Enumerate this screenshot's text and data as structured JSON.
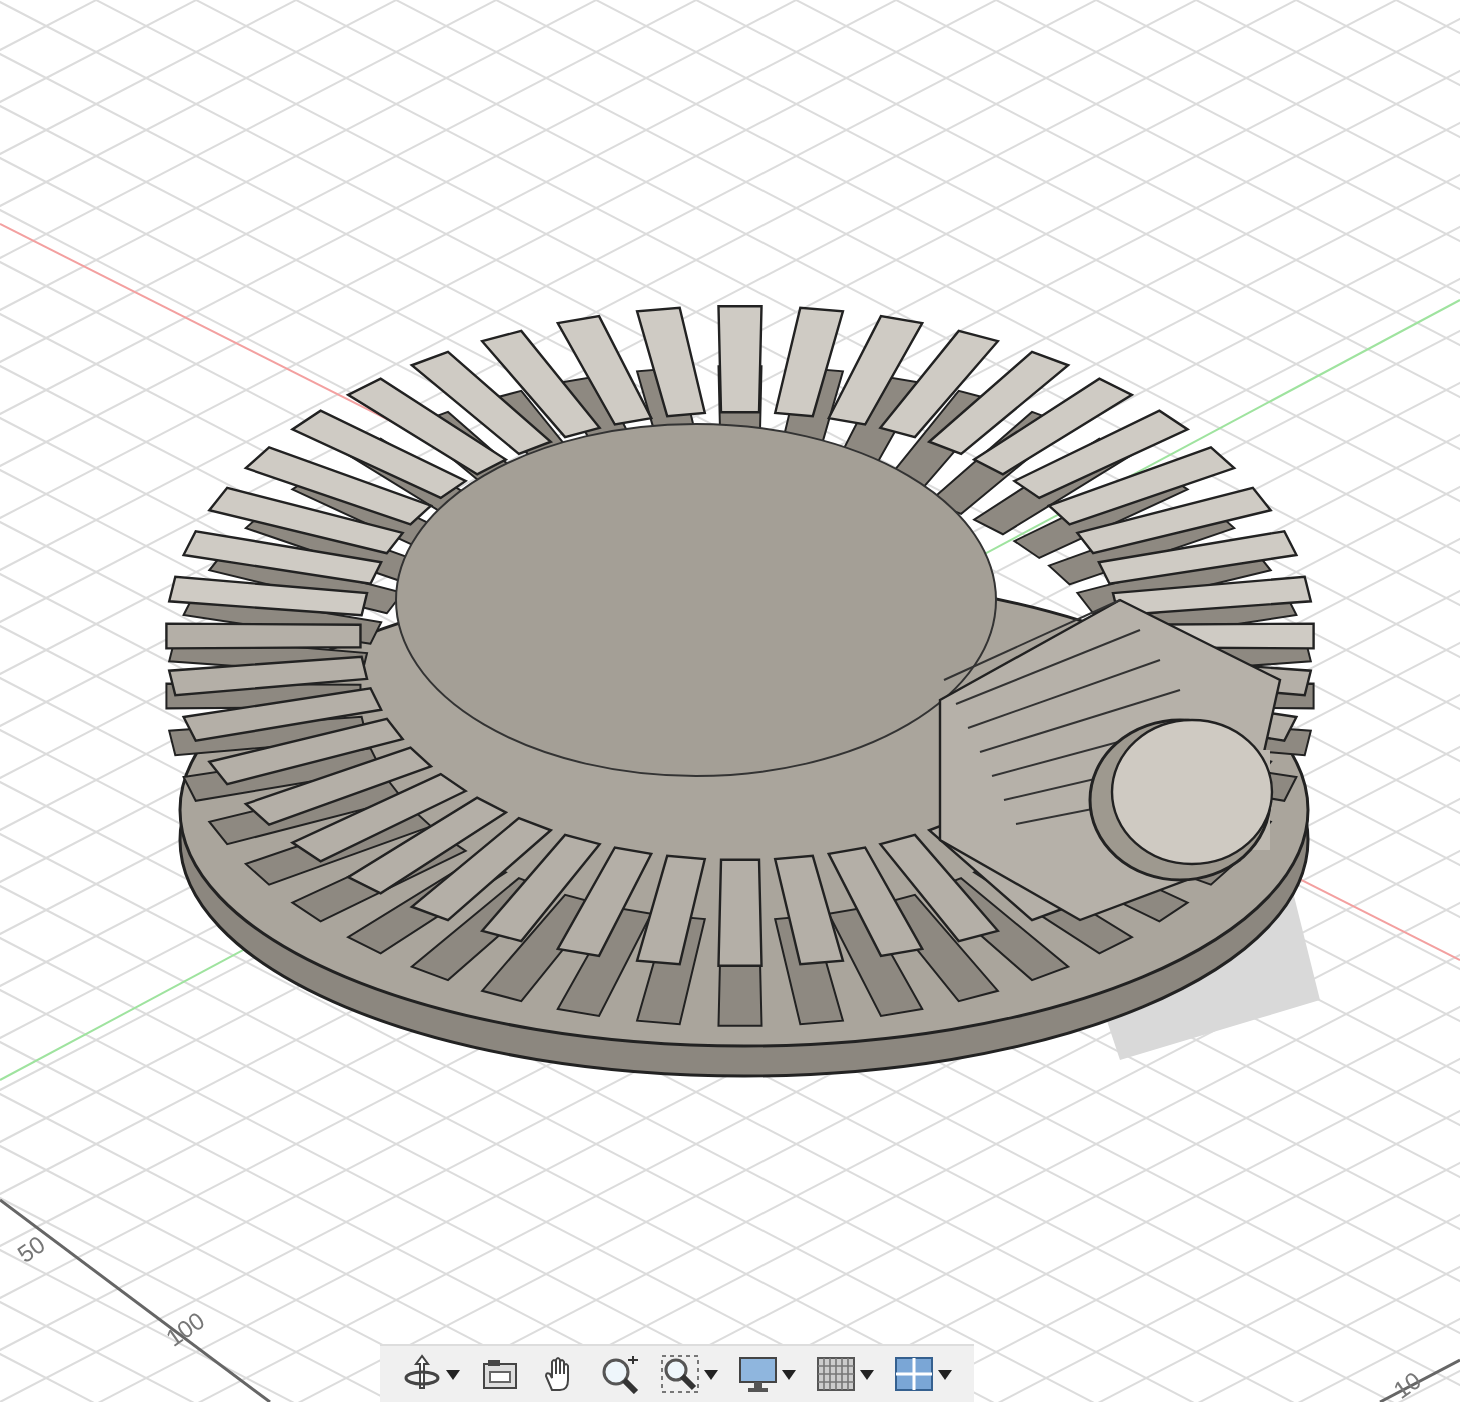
{
  "viewport": {
    "grid_labels": [
      {
        "text": "50",
        "kind": "left"
      },
      {
        "text": "100",
        "kind": "bottom"
      },
      {
        "text": "10",
        "kind": "corner"
      }
    ]
  },
  "navigation_toolbar": [
    {
      "kind": "orbit",
      "has_menu": true
    },
    {
      "kind": "look-at",
      "has_menu": false
    },
    {
      "kind": "pan",
      "has_menu": false
    },
    {
      "kind": "zoom",
      "has_menu": false
    },
    {
      "kind": "fit",
      "has_menu": true
    },
    {
      "kind": "display",
      "has_menu": true
    },
    {
      "kind": "grid",
      "has_menu": true
    },
    {
      "kind": "viewports",
      "has_menu": true
    }
  ]
}
